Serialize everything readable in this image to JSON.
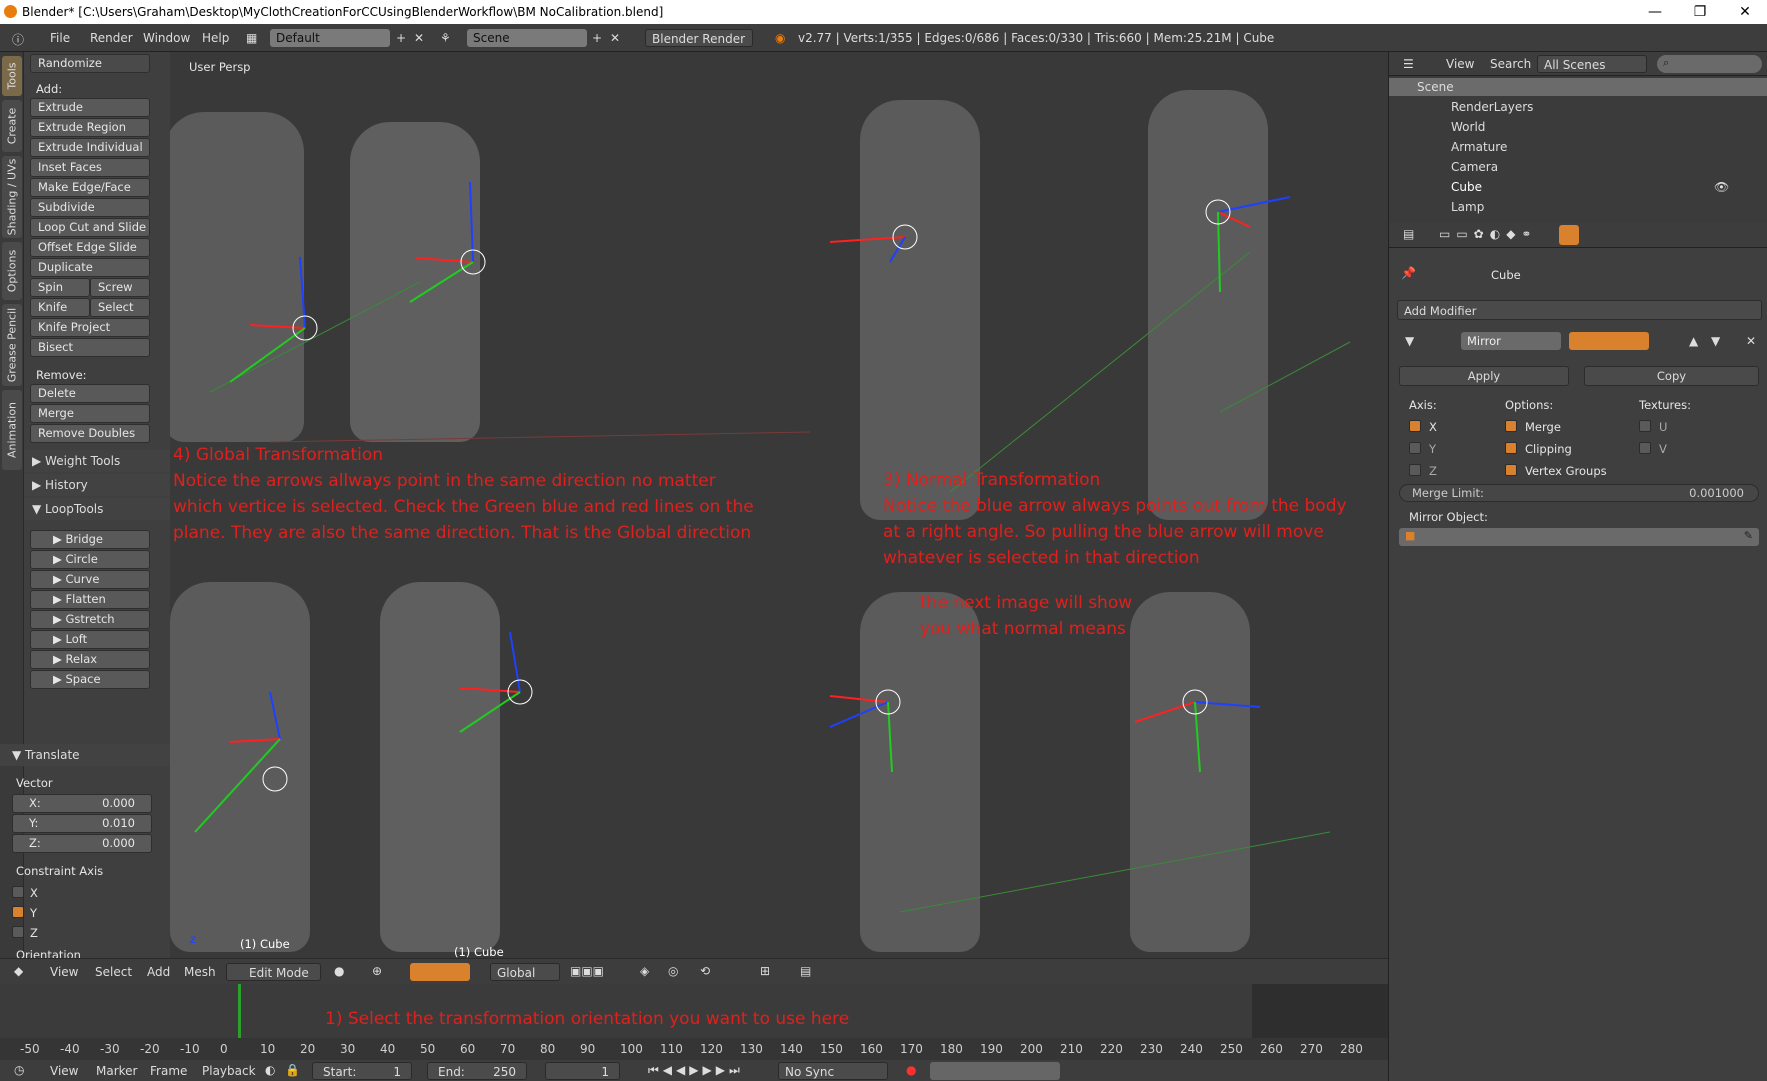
{
  "window": {
    "title": "Blender* [C:\\Users\\Graham\\Desktop\\MyClothCreationForCCUsingBlenderWorkflow\\BM NoCalibration.blend]",
    "minimize": "—",
    "restore": "❐",
    "close": "✕"
  },
  "topbar": {
    "menus": [
      "File",
      "Render",
      "Window",
      "Help"
    ],
    "layout": "Default",
    "scene": "Scene",
    "engine": "Blender Render",
    "stats": "v2.77 | Verts:1/355 | Edges:0/686 | Faces:0/330 | Tris:660 | Mem:25.21M | Cube"
  },
  "lefttabs": [
    "Tools",
    "Create",
    "Shading / UVs",
    "Options",
    "Grease Pencil",
    "Animation"
  ],
  "tools": {
    "randomize": "Randomize",
    "add_label": "Add:",
    "extrude": "Extrude",
    "extrude_region": "Extrude Region",
    "extrude_individual": "Extrude Individual",
    "inset_faces": "Inset Faces",
    "make_edge_face": "Make Edge/Face",
    "subdivide": "Subdivide",
    "loop_cut": "Loop Cut and Slide",
    "offset_edge": "Offset Edge Slide",
    "duplicate": "Duplicate",
    "spin": "Spin",
    "screw": "Screw",
    "knife": "Knife",
    "select": "Select",
    "knife_project": "Knife Project",
    "bisect": "Bisect",
    "remove_label": "Remove:",
    "delete": "Delete",
    "merge": "Merge",
    "remove_doubles": "Remove Doubles",
    "weight_tools": "Weight Tools",
    "history": "History",
    "looptools": "LoopTools",
    "loop_items": [
      "Bridge",
      "Circle",
      "Curve",
      "Flatten",
      "Gstretch",
      "Loft",
      "Relax",
      "Space"
    ]
  },
  "operator": {
    "title": "Translate",
    "vector": "Vector",
    "x_label": "X:",
    "x": "0.000",
    "y_label": "Y:",
    "y": "0.010",
    "z_label": "Z:",
    "z": "0.000",
    "constraint": "Constraint Axis",
    "cx": "X",
    "cy": "Y",
    "cz": "Z",
    "orientation": "Orientation"
  },
  "viewport": {
    "label": "User Persp",
    "obj1": "(1) Cube",
    "obj2": "(1) Cube",
    "note_global": "4) Global Transformation\nNotice the arrows allways point in the same direction no matter\nwhich vertice is selected. Check the Green blue and red lines on the\nplane. They are also the same direction. That is the Global direction",
    "note_normal": "3) Normal Transformation\nNotice the blue arrow always points out from the body\nat a right angle. So pulling the blue arrow will move\nwhatever is selected in that direction",
    "note_next": "the next image will show\nyou what normal means",
    "note_select": "1) Select the transformation orientation you want to use here"
  },
  "viewhdr": {
    "view": "View",
    "select": "Select",
    "add": "Add",
    "mesh": "Mesh",
    "mode": "Edit Mode",
    "orientation": "Global"
  },
  "timeline": {
    "ticks": [
      "-50",
      "-40",
      "-30",
      "-20",
      "-10",
      "0",
      "10",
      "20",
      "30",
      "40",
      "50",
      "60",
      "70",
      "80",
      "90",
      "100",
      "110",
      "120",
      "130",
      "140",
      "150",
      "160",
      "170",
      "180",
      "190",
      "200",
      "210",
      "220",
      "230",
      "240",
      "250",
      "260",
      "270",
      "280"
    ],
    "view": "View",
    "marker": "Marker",
    "frame": "Frame",
    "playback": "Playback",
    "start": "Start:",
    "start_val": "1",
    "end": "End:",
    "end_val": "250",
    "current": "1",
    "sync": "No Sync"
  },
  "outliner": {
    "view": "View",
    "search": "Search",
    "scenes": "All Scenes",
    "items": [
      "Scene",
      "RenderLayers",
      "World",
      "Armature",
      "Camera",
      "Cube",
      "Lamp"
    ]
  },
  "props": {
    "object": "Cube",
    "add_modifier": "Add Modifier",
    "modifier_name": "Mirror",
    "apply": "Apply",
    "copy": "Copy",
    "axis": "Axis:",
    "options": "Options:",
    "textures": "Textures:",
    "ax": "X",
    "ay": "Y",
    "az": "Z",
    "merge": "Merge",
    "clipping": "Clipping",
    "vgroups": "Vertex Groups",
    "tu": "U",
    "tv": "V",
    "merge_limit": "Merge Limit:",
    "merge_limit_val": "0.001000",
    "mirror_object": "Mirror Object:"
  },
  "colors": {
    "accent": "#d9812c",
    "note": "#e0201c",
    "viewport": "#393939"
  }
}
